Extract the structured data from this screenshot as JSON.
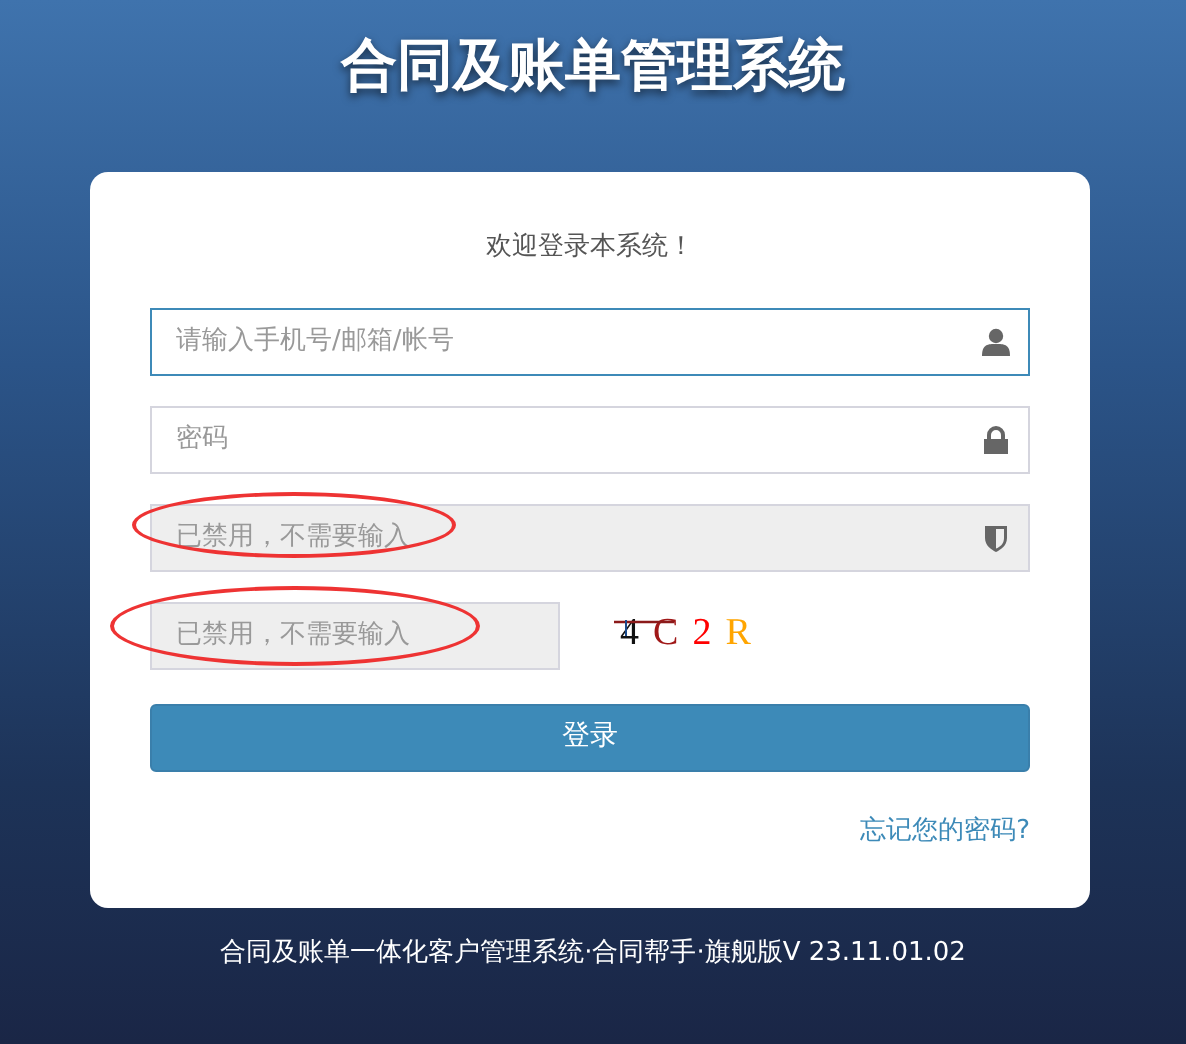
{
  "title": "合同及账单管理系统",
  "welcome": "欢迎登录本系统！",
  "fields": [
    {
      "placeholder": "请输入手机号/邮箱/帐号",
      "kind": "user",
      "disabled": false,
      "focused": true,
      "circled": false
    },
    {
      "placeholder": "密码",
      "kind": "lock",
      "disabled": false,
      "focused": false,
      "circled": false
    },
    {
      "placeholder": "已禁用，不需要输入",
      "kind": "shield",
      "disabled": true,
      "focused": false,
      "circled": true
    }
  ],
  "captcha_field": {
    "placeholder": "已禁用，不需要输入",
    "disabled": true,
    "circled": true
  },
  "captcha": [
    {
      "char": "4",
      "color": "#111111"
    },
    {
      "char": "C",
      "color": "#a01818"
    },
    {
      "char": "2",
      "color": "#ff0000"
    },
    {
      "char": "R",
      "color": "#ffa500"
    }
  ],
  "login_button": "登录",
  "forgot_link": "忘记您的密码?",
  "footer": "合同及账单一体化客户管理系统·合同帮手·旗舰版V 23.11.01.02"
}
